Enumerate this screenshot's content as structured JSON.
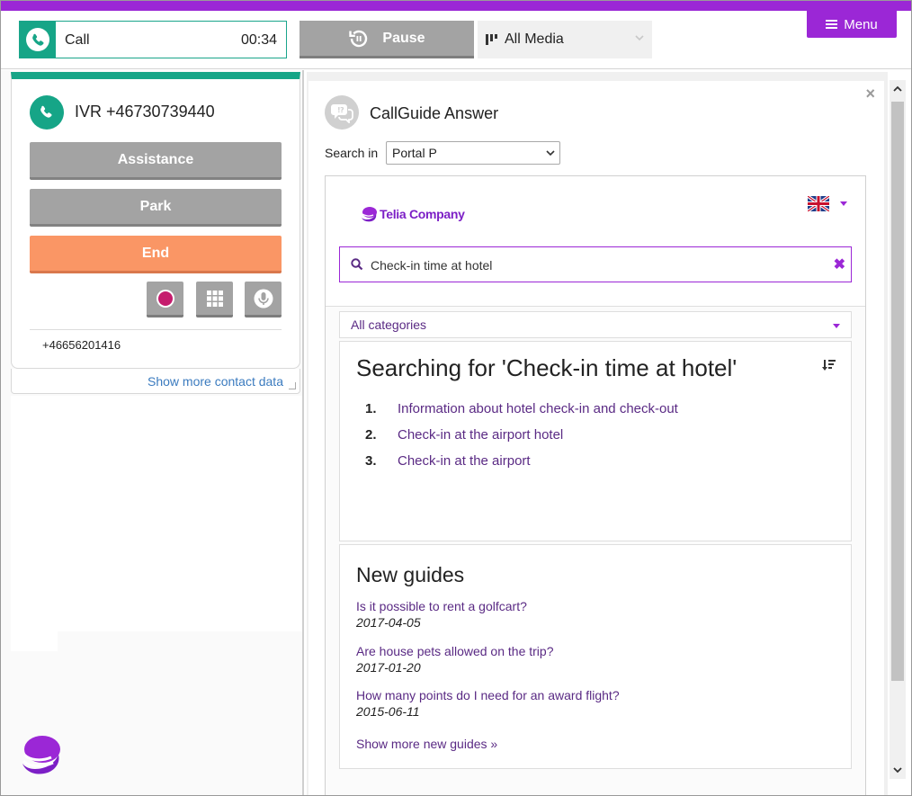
{
  "topbar": {
    "call_label": "Call",
    "call_timer": "00:34",
    "pause_label": "Pause",
    "media_label": "All Media",
    "menu_label": "Menu"
  },
  "contact": {
    "caller": "IVR +46730739440",
    "assistance_label": "Assistance",
    "park_label": "Park",
    "end_label": "End",
    "phone_number": "+46656201416",
    "show_more_label": "Show more contact data"
  },
  "callguide": {
    "title": "CallGuide Answer",
    "search_in_label": "Search in",
    "portal_value": "Portal P",
    "brand_name": "Telia Company",
    "search_value": "Check-in time at hotel",
    "clear_label": "✖",
    "category_value": "All categories",
    "results_title": "Searching for 'Check-in time at hotel'",
    "results": [
      {
        "num": "1.",
        "text": "Information about hotel check-in and check-out"
      },
      {
        "num": "2.",
        "text": "Check-in at the airport hotel"
      },
      {
        "num": "3.",
        "text": "Check-in at the airport"
      }
    ],
    "new_guides_title": "New guides",
    "new_guides": [
      {
        "question": "Is it possible to rent a golfcart?",
        "date": "2017-04-05"
      },
      {
        "question": "Are house pets allowed on the trip?",
        "date": "2017-01-20"
      },
      {
        "question": "How many points do I need for an award flight?",
        "date": "2015-06-11"
      }
    ],
    "show_more_guides": "Show more new guides »",
    "close_label": "×"
  },
  "colors": {
    "accent_purple": "#9b27d6",
    "call_green": "#16a587",
    "end_orange": "#fa9665",
    "button_gray": "#a3a3a3",
    "link_purple": "#5a2a84"
  },
  "icons": {
    "call": "phone-icon",
    "pause": "pause-cycle-icon",
    "media": "media-bars-icon",
    "menu": "hamburger-icon",
    "record": "record-icon",
    "keypad": "keypad-icon",
    "mic": "microphone-icon",
    "callguide": "chat-bubbles-icon",
    "search": "search-icon",
    "sort": "sort-icon",
    "flag": "uk-flag-icon"
  }
}
